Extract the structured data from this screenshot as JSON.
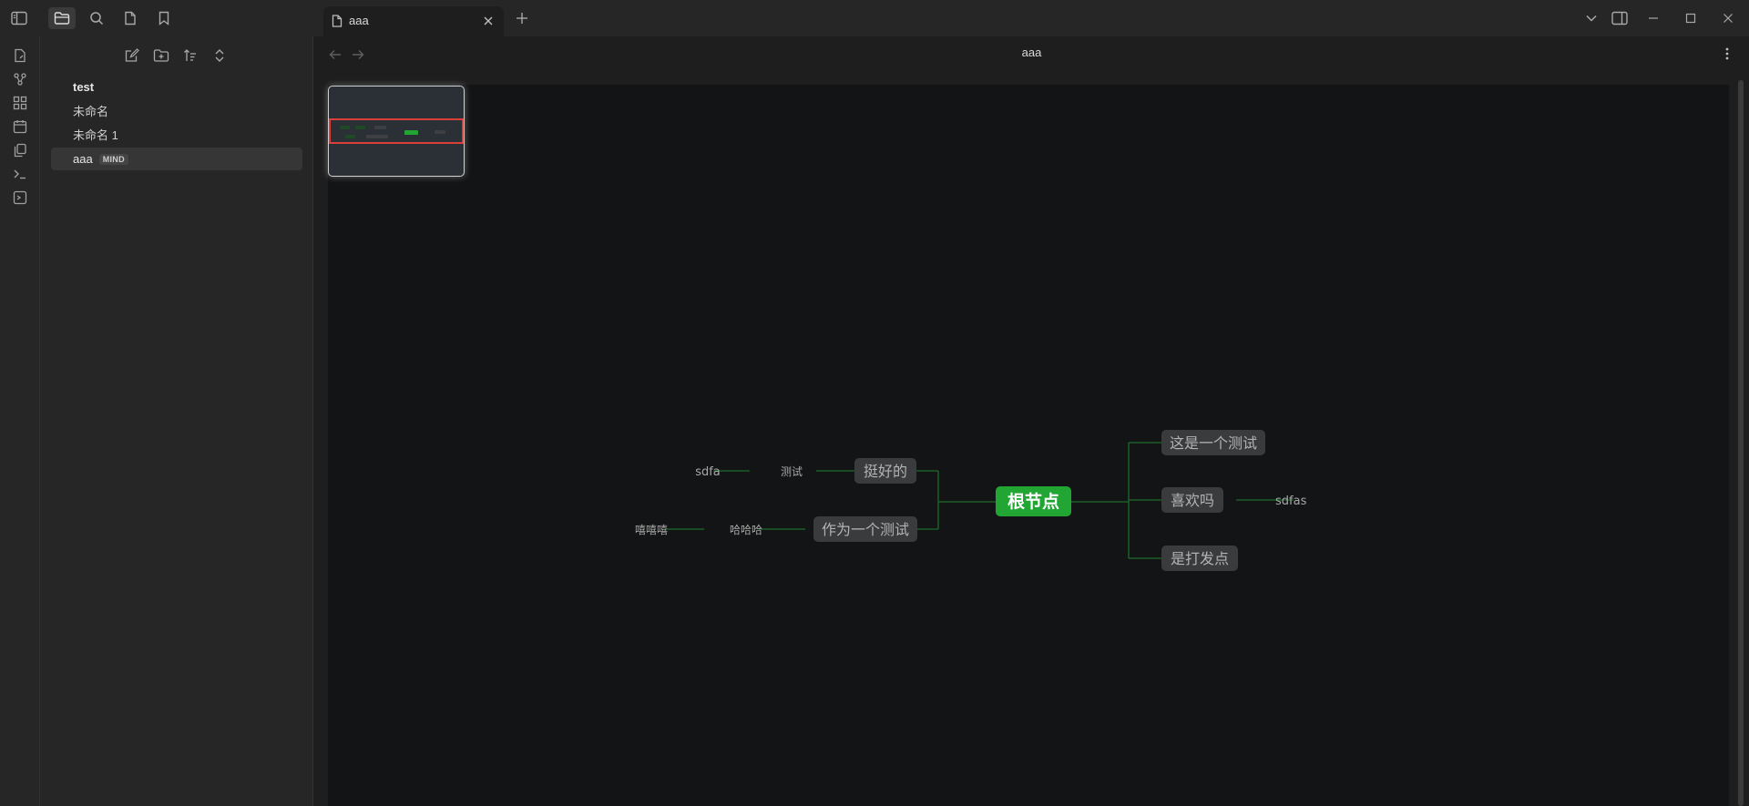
{
  "topbar": {
    "tab_title": "aaa",
    "left_icons": [
      "sidebar-toggle-icon",
      "folder-icon",
      "search-icon",
      "file-icon",
      "bookmark-icon"
    ],
    "right_icons": [
      "chevron-down-icon",
      "split-pane-icon",
      "minimize-icon",
      "maximize-icon",
      "close-icon"
    ]
  },
  "ribbon": {
    "icons": [
      "new-note-icon",
      "graph-icon",
      "canvas-icon",
      "calendar-icon",
      "copy-icon",
      "terminal-icon",
      "command-icon"
    ]
  },
  "sidebar": {
    "tools": [
      "new-note-icon",
      "new-folder-icon",
      "sort-icon",
      "collapse-icon"
    ],
    "files": [
      {
        "label": "test",
        "badge": ""
      },
      {
        "label": "未命名",
        "badge": ""
      },
      {
        "label": "未命名 1",
        "badge": ""
      },
      {
        "label": "aaa",
        "badge": "MIND"
      }
    ]
  },
  "main": {
    "view_title": "aaa"
  },
  "mindmap": {
    "root": "根节点",
    "colors": {
      "root_bg": "#21a634",
      "node_bg": "#3a3b3c",
      "edge": "#1d6b2a",
      "canvas": "#131415"
    },
    "nodes": {
      "n1": "这是一个测试",
      "n2": "喜欢吗",
      "n2a": "sdfas",
      "n3": "是打发点",
      "n4": "挺好的",
      "n4a": "测试",
      "n4b": "sdfa",
      "n5": "作为一个测试",
      "n5a": "哈哈哈",
      "n5b": "嘻嘻嘻"
    }
  }
}
